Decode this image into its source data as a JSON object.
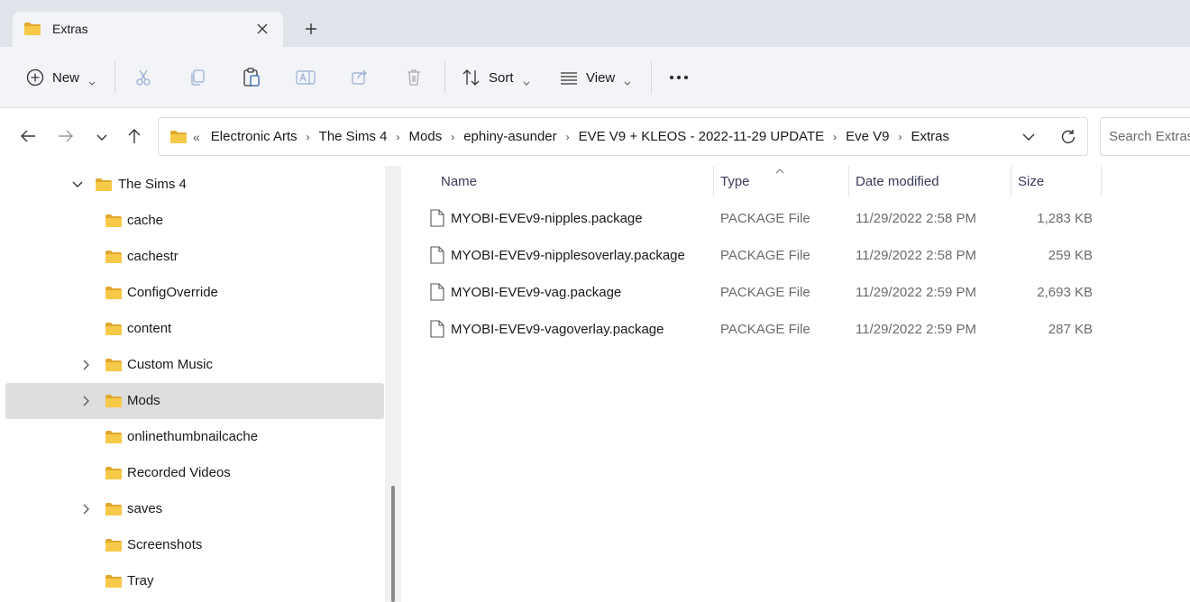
{
  "window": {
    "tab_title": "Extras",
    "tab_icon": "folder-icon",
    "close_icon": "close-icon",
    "new_tab_icon": "plus-icon"
  },
  "toolbar": {
    "new_label": "New",
    "sort_label": "Sort",
    "view_label": "View",
    "icons": [
      "plus-circle-icon",
      "cut-icon",
      "copy-icon",
      "paste-icon",
      "rename-icon",
      "share-icon",
      "delete-icon",
      "sort-icon",
      "view-icon",
      "more-icon"
    ]
  },
  "address": {
    "overflow_glyph": "«",
    "crumbs": [
      "Electronic Arts",
      "The Sims 4",
      "Mods",
      "ephiny-asunder",
      "EVE V9 + KLEOS - 2022-11-29 UPDATE",
      "Eve V9",
      "Extras"
    ],
    "separator_glyph": "›",
    "search_placeholder": "Search Extras"
  },
  "nav_tree": [
    {
      "label": "The Sims 4",
      "expanded": true,
      "selected": false,
      "has_children": true
    },
    {
      "label": "cache",
      "expanded": false,
      "selected": false,
      "has_children": false
    },
    {
      "label": "cachestr",
      "expanded": false,
      "selected": false,
      "has_children": false
    },
    {
      "label": "ConfigOverride",
      "expanded": false,
      "selected": false,
      "has_children": false
    },
    {
      "label": "content",
      "expanded": false,
      "selected": false,
      "has_children": false
    },
    {
      "label": "Custom Music",
      "expanded": false,
      "selected": false,
      "has_children": true
    },
    {
      "label": "Mods",
      "expanded": false,
      "selected": true,
      "has_children": true
    },
    {
      "label": "onlinethumbnailcache",
      "expanded": false,
      "selected": false,
      "has_children": false
    },
    {
      "label": "Recorded Videos",
      "expanded": false,
      "selected": false,
      "has_children": false
    },
    {
      "label": "saves",
      "expanded": false,
      "selected": false,
      "has_children": true
    },
    {
      "label": "Screenshots",
      "expanded": false,
      "selected": false,
      "has_children": false
    },
    {
      "label": "Tray",
      "expanded": false,
      "selected": false,
      "has_children": false
    }
  ],
  "file_list": {
    "columns": [
      "Name",
      "Type",
      "Date modified",
      "Size"
    ],
    "sorted_column": "Type",
    "rows": [
      {
        "name": "MYOBI-EVEv9-nipples.package",
        "type": "PACKAGE File",
        "date": "11/29/2022 2:58 PM",
        "size": "1,283 KB"
      },
      {
        "name": "MYOBI-EVEv9-nipplesoverlay.package",
        "type": "PACKAGE File",
        "date": "11/29/2022 2:58 PM",
        "size": "259 KB"
      },
      {
        "name": "MYOBI-EVEv9-vag.package",
        "type": "PACKAGE File",
        "date": "11/29/2022 2:59 PM",
        "size": "2,693 KB"
      },
      {
        "name": "MYOBI-EVEv9-vagoverlay.package",
        "type": "PACKAGE File",
        "date": "11/29/2022 2:59 PM",
        "size": "287 KB"
      }
    ]
  },
  "colors": {
    "folder": "#f7c948",
    "folder_dark": "#e0a82e",
    "selected_row": "#dedede",
    "tabstrip_bg": "#dfe3ea",
    "toolbar_bg": "#f3f4f8"
  }
}
